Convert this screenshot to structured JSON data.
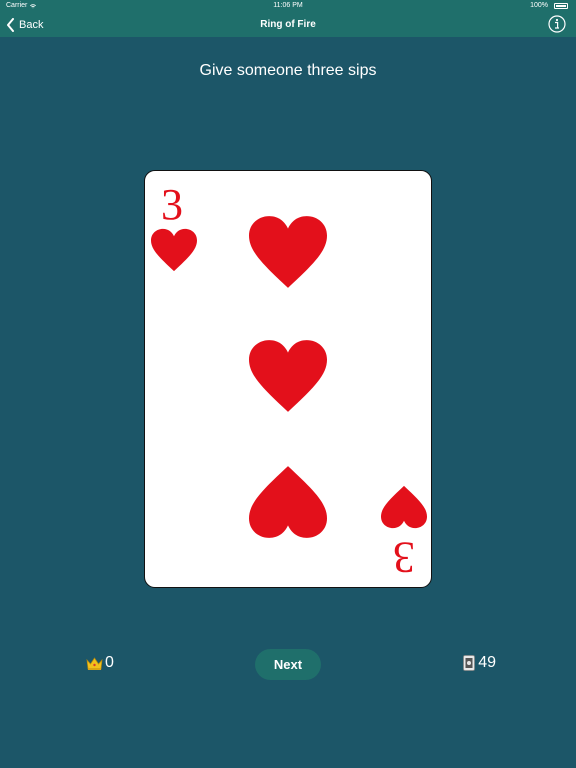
{
  "status_bar": {
    "carrier": "Carrier",
    "time": "11:06 PM",
    "battery": "100%"
  },
  "nav": {
    "back_label": "Back",
    "title": "Ring of Fire"
  },
  "prompt": "Give someone three sips",
  "card": {
    "rank": "3",
    "suit": "hearts",
    "color": "#e3101b"
  },
  "footer": {
    "crowns_count": "0",
    "next_label": "Next",
    "cards_remaining": "49"
  },
  "colors": {
    "background": "#1c5668",
    "navbar": "#1f6f6b",
    "button": "#1f6f6b"
  },
  "icons": {
    "back": "chevron-left-icon",
    "info": "info-icon",
    "crown": "crown-icon",
    "deck": "card-deck-icon",
    "wifi": "wifi-icon",
    "battery": "battery-icon"
  }
}
